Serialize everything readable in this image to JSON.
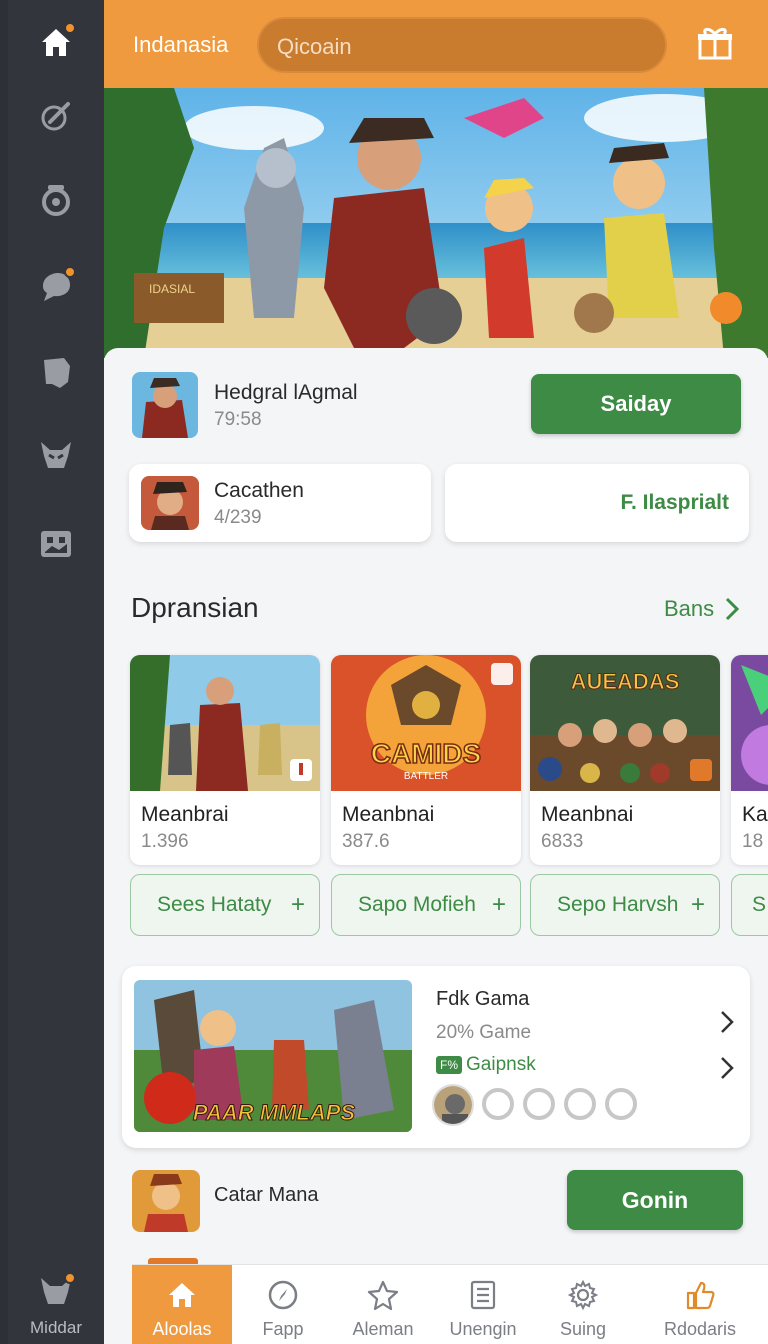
{
  "sidebar": {
    "items": [
      {
        "icon": "home-icon",
        "badge": true
      },
      {
        "icon": "brush-icon",
        "badge": false
      },
      {
        "icon": "gamepad-icon",
        "badge": false
      },
      {
        "icon": "chat-icon",
        "badge": true
      },
      {
        "icon": "shield-icon",
        "badge": false
      },
      {
        "icon": "creature-icon",
        "badge": false
      },
      {
        "icon": "gallery-icon",
        "badge": false
      }
    ],
    "bottom_icon": "profile-icon",
    "bottom_label": "Middar"
  },
  "header": {
    "brand": "Indanasia",
    "search_placeholder": "Qicoain",
    "gift_icon": "gift-icon"
  },
  "list": [
    {
      "title": "Hedgral lAgmal",
      "sub": "79:58",
      "button": "Saiday"
    },
    {
      "title": "Cacathen",
      "sub": "4/239",
      "button": "F. Ilasprialt"
    }
  ],
  "section": {
    "title": "Dpransian",
    "see_all": "Bans"
  },
  "games": [
    {
      "name": "Meanbrai",
      "num": "1.396",
      "action": "Sees Hataty"
    },
    {
      "name": "Meanbnai",
      "num": "387.6",
      "action": "Sapo Mofieh",
      "art_title": "CAMIDS",
      "art_sub": "BATTLER"
    },
    {
      "name": "Meanbnai",
      "num": "6833",
      "action": "Sepo Harvsh",
      "art_title": "AUEADAS"
    },
    {
      "name": "Kar",
      "num": "18",
      "action": "S"
    }
  ],
  "feature": {
    "title": "Fdk Gama",
    "sub": "20% Game",
    "tag": "F%",
    "tag_label": "Gaipnsk",
    "art_title": "PAAR MMLAPS"
  },
  "bottom_row": {
    "title": "Catar Mana",
    "button": "Gonin"
  },
  "nav": [
    {
      "label": "Aloolas",
      "icon": "home-icon",
      "active": true
    },
    {
      "label": "Fapp",
      "icon": "compass-icon",
      "active": false
    },
    {
      "label": "Aleman",
      "icon": "star-icon",
      "active": false
    },
    {
      "label": "Unengin",
      "icon": "list-icon",
      "active": false
    },
    {
      "label": "Suing",
      "icon": "gear-icon",
      "active": false
    },
    {
      "label": "Rdodaris",
      "icon": "thumb-up-icon",
      "active": false
    }
  ],
  "colors": {
    "accent": "#ef9a3e",
    "green": "#3d8b45",
    "sidebar": "#33353d"
  }
}
